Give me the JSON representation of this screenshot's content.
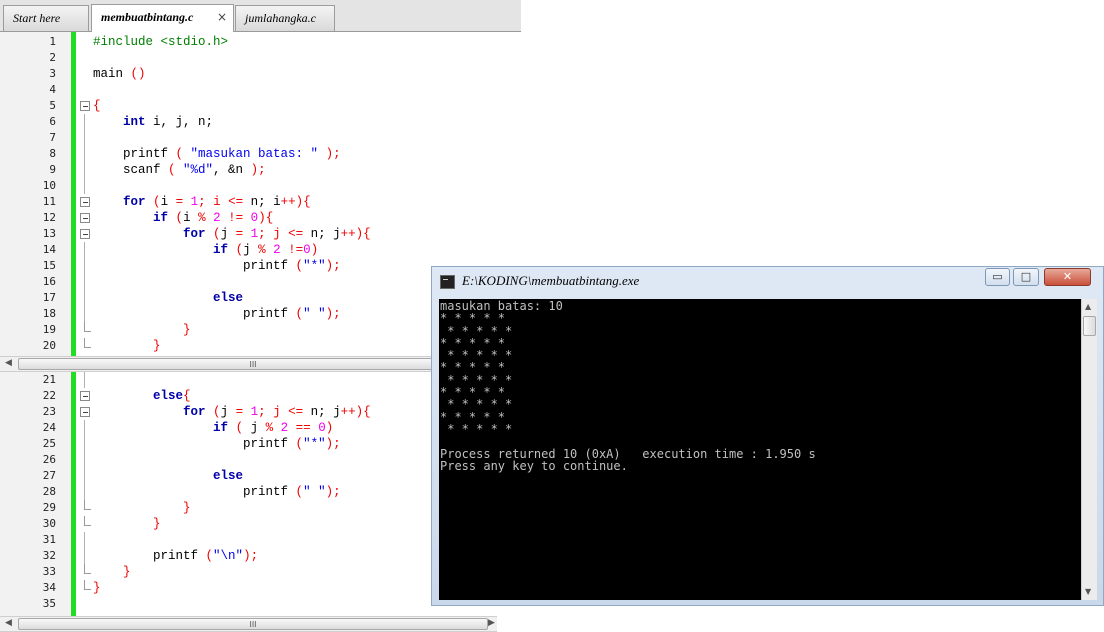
{
  "editor": {
    "tabs": [
      {
        "label": "Start here"
      },
      {
        "label": "membuatbintang.c",
        "close": "×"
      },
      {
        "label": "jumlahangka.c"
      }
    ],
    "scroll_grip": "III",
    "pane1": [
      {
        "n": "1",
        "code": [
          [
            "#include <stdio.h>",
            "pp"
          ]
        ]
      },
      {
        "n": "2",
        "code": []
      },
      {
        "n": "3",
        "code": [
          [
            "main ",
            ""
          ],
          [
            "()",
            "op"
          ]
        ]
      },
      {
        "n": "4",
        "code": []
      },
      {
        "n": "5",
        "fold": "open",
        "code": [
          [
            "{",
            "op"
          ]
        ]
      },
      {
        "n": "6",
        "fold": "line",
        "code": [
          [
            "    ",
            ""
          ],
          [
            "int",
            "kw"
          ],
          [
            " i, j, n;",
            ""
          ]
        ]
      },
      {
        "n": "7",
        "fold": "line",
        "code": []
      },
      {
        "n": "8",
        "fold": "line",
        "code": [
          [
            "    printf ",
            ""
          ],
          [
            "( ",
            "op"
          ],
          [
            "\"masukan batas: \"",
            "st"
          ],
          [
            " );",
            "op"
          ]
        ]
      },
      {
        "n": "9",
        "fold": "line",
        "code": [
          [
            "    scanf ",
            ""
          ],
          [
            "( ",
            "op"
          ],
          [
            "\"%d\"",
            "st"
          ],
          [
            ", &n ",
            ""
          ],
          [
            ");",
            "op"
          ]
        ]
      },
      {
        "n": "10",
        "fold": "line",
        "code": []
      },
      {
        "n": "11",
        "fold": "open",
        "code": [
          [
            "    ",
            ""
          ],
          [
            "for",
            "kw"
          ],
          [
            " ",
            ""
          ],
          [
            "(",
            "op"
          ],
          [
            "i ",
            ""
          ],
          [
            "=",
            "op"
          ],
          [
            " ",
            ""
          ],
          [
            "1",
            "num"
          ],
          [
            "; i ",
            "op"
          ],
          [
            "<=",
            "op"
          ],
          [
            " n; i",
            ""
          ],
          [
            "++){",
            "op"
          ]
        ]
      },
      {
        "n": "12",
        "fold": "open",
        "code": [
          [
            "        ",
            ""
          ],
          [
            "if",
            "kw"
          ],
          [
            " ",
            ""
          ],
          [
            "(",
            "op"
          ],
          [
            "i ",
            ""
          ],
          [
            "%",
            "op"
          ],
          [
            " ",
            ""
          ],
          [
            "2",
            "num"
          ],
          [
            " ",
            ""
          ],
          [
            "!=",
            "op"
          ],
          [
            " ",
            ""
          ],
          [
            "0",
            "num"
          ],
          [
            "){",
            "op"
          ]
        ]
      },
      {
        "n": "13",
        "fold": "open",
        "code": [
          [
            "            ",
            ""
          ],
          [
            "for",
            "kw"
          ],
          [
            " ",
            ""
          ],
          [
            "(",
            "op"
          ],
          [
            "j ",
            ""
          ],
          [
            "=",
            "op"
          ],
          [
            " ",
            ""
          ],
          [
            "1",
            "num"
          ],
          [
            "; j ",
            "op"
          ],
          [
            "<=",
            "op"
          ],
          [
            " n; j",
            ""
          ],
          [
            "++){",
            "op"
          ]
        ]
      },
      {
        "n": "14",
        "fold": "line",
        "code": [
          [
            "                ",
            ""
          ],
          [
            "if",
            "kw"
          ],
          [
            " ",
            ""
          ],
          [
            "(",
            "op"
          ],
          [
            "j ",
            ""
          ],
          [
            "%",
            "op"
          ],
          [
            " ",
            ""
          ],
          [
            "2",
            "num"
          ],
          [
            " ",
            ""
          ],
          [
            "!=",
            "op"
          ],
          [
            "0",
            "num"
          ],
          [
            ")",
            "op"
          ]
        ]
      },
      {
        "n": "15",
        "fold": "line",
        "code": [
          [
            "                    printf ",
            ""
          ],
          [
            "(",
            "op"
          ],
          [
            "\"*\"",
            "st"
          ],
          [
            ");",
            "op"
          ]
        ]
      },
      {
        "n": "16",
        "fold": "line",
        "code": []
      },
      {
        "n": "17",
        "fold": "line",
        "code": [
          [
            "                ",
            ""
          ],
          [
            "else",
            "kw"
          ]
        ]
      },
      {
        "n": "18",
        "fold": "line",
        "code": [
          [
            "                    printf ",
            ""
          ],
          [
            "(",
            "op"
          ],
          [
            "\" \"",
            "st"
          ],
          [
            ");",
            "op"
          ]
        ]
      },
      {
        "n": "19",
        "fold": "end",
        "code": [
          [
            "            ",
            ""
          ],
          [
            "}",
            "op"
          ]
        ]
      },
      {
        "n": "20",
        "fold": "end",
        "code": [
          [
            "        ",
            ""
          ],
          [
            "}",
            "op"
          ]
        ]
      }
    ],
    "pane2": [
      {
        "n": "21",
        "fold": "line",
        "code": []
      },
      {
        "n": "22",
        "fold": "open",
        "code": [
          [
            "        ",
            ""
          ],
          [
            "else",
            "kw"
          ],
          [
            "{",
            "op"
          ]
        ]
      },
      {
        "n": "23",
        "fold": "open",
        "code": [
          [
            "            ",
            ""
          ],
          [
            "for",
            "kw"
          ],
          [
            " ",
            ""
          ],
          [
            "(",
            "op"
          ],
          [
            "j ",
            ""
          ],
          [
            "=",
            "op"
          ],
          [
            " ",
            ""
          ],
          [
            "1",
            "num"
          ],
          [
            "; j ",
            "op"
          ],
          [
            "<=",
            "op"
          ],
          [
            " n; j",
            ""
          ],
          [
            "++){",
            "op"
          ]
        ]
      },
      {
        "n": "24",
        "fold": "line",
        "code": [
          [
            "                ",
            ""
          ],
          [
            "if",
            "kw"
          ],
          [
            " ",
            ""
          ],
          [
            "( ",
            "op"
          ],
          [
            "j ",
            ""
          ],
          [
            "%",
            "op"
          ],
          [
            " ",
            ""
          ],
          [
            "2",
            "num"
          ],
          [
            " ",
            ""
          ],
          [
            "==",
            "op"
          ],
          [
            " ",
            ""
          ],
          [
            "0",
            "num"
          ],
          [
            ")",
            "op"
          ]
        ]
      },
      {
        "n": "25",
        "fold": "line",
        "code": [
          [
            "                    printf ",
            ""
          ],
          [
            "(",
            "op"
          ],
          [
            "\"*\"",
            "st"
          ],
          [
            ");",
            "op"
          ]
        ]
      },
      {
        "n": "26",
        "fold": "line",
        "code": []
      },
      {
        "n": "27",
        "fold": "line",
        "code": [
          [
            "                ",
            ""
          ],
          [
            "else",
            "kw"
          ]
        ]
      },
      {
        "n": "28",
        "fold": "line",
        "code": [
          [
            "                    printf ",
            ""
          ],
          [
            "(",
            "op"
          ],
          [
            "\" \"",
            "st"
          ],
          [
            ");",
            "op"
          ]
        ]
      },
      {
        "n": "29",
        "fold": "end",
        "code": [
          [
            "            ",
            ""
          ],
          [
            "}",
            "op"
          ]
        ]
      },
      {
        "n": "30",
        "fold": "end",
        "code": [
          [
            "        ",
            ""
          ],
          [
            "}",
            "op"
          ]
        ]
      },
      {
        "n": "31",
        "fold": "line",
        "code": []
      },
      {
        "n": "32",
        "fold": "line",
        "code": [
          [
            "        printf ",
            ""
          ],
          [
            "(",
            "op"
          ],
          [
            "\"\\n\"",
            "st"
          ],
          [
            ");",
            "op"
          ]
        ]
      },
      {
        "n": "33",
        "fold": "end",
        "code": [
          [
            "    ",
            ""
          ],
          [
            "}",
            "op"
          ]
        ]
      },
      {
        "n": "34",
        "fold": "end",
        "code": [
          [
            "}",
            "op"
          ]
        ]
      },
      {
        "n": "35",
        "code": []
      }
    ]
  },
  "console": {
    "title": "E:\\KODING\\membuatbintang.exe",
    "buttons": {
      "minimize": "▭",
      "maximize": "□",
      "close": "✕"
    },
    "output_lines": [
      "masukan batas: 10",
      "* * * * *",
      " * * * * *",
      "* * * * *",
      " * * * * *",
      "* * * * *",
      " * * * * *",
      "* * * * *",
      " * * * * *",
      "* * * * *",
      " * * * * *",
      "",
      "Process returned 10 (0xA)   execution time : 1.950 s",
      "Press any key to continue."
    ]
  }
}
